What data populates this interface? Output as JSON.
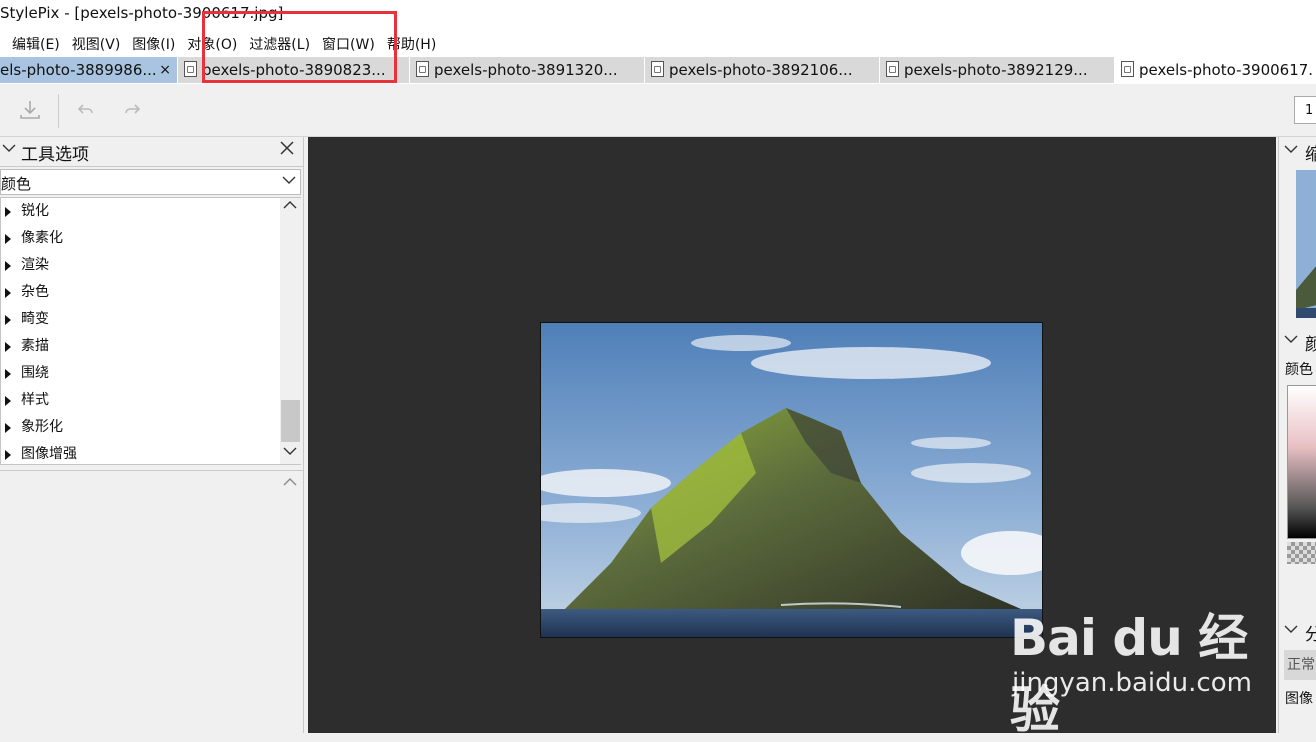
{
  "window": {
    "title": "StylePix - [pexels-photo-3900617.jpg]"
  },
  "menubar": {
    "items": [
      "编辑(E)",
      "视图(V)",
      "图像(I)",
      "对象(O)",
      "过滤器(L)",
      "窗口(W)",
      "帮助(H)"
    ]
  },
  "tabs": [
    {
      "label": "els-photo-3889986...",
      "close": "×",
      "state": "selected"
    },
    {
      "label": "pexels-photo-3890823...",
      "state": "normal"
    },
    {
      "label": "pexels-photo-3891320...",
      "state": "normal"
    },
    {
      "label": "pexels-photo-3892106...",
      "state": "normal"
    },
    {
      "label": "pexels-photo-3892129...",
      "state": "normal"
    },
    {
      "label": "pexels-photo-3900617.",
      "state": "active"
    }
  ],
  "toolbar": {
    "download_icon": "download-icon",
    "undo_icon": "undo-icon",
    "redo_icon": "redo-icon",
    "zoom_value": "1"
  },
  "tool_options": {
    "title": "工具选项",
    "category": "颜色",
    "filters": [
      "锐化",
      "像素化",
      "渲染",
      "杂色",
      "畸变",
      "素描",
      "围绕",
      "样式",
      "象形化",
      "图像增强"
    ]
  },
  "right_panel": {
    "navigator_label": "缩",
    "color_label": "颜",
    "color_sub": "颜色",
    "layers_label": "分",
    "blend_mode": "正常",
    "image_label": "图像"
  },
  "watermark": {
    "brand": "Bai du 经验",
    "url": "jingyan.baidu.com"
  },
  "colors": {
    "highlight": "#e8323b",
    "canvas": "#2d2d2d",
    "selected_tab": "#a8c4e0"
  }
}
